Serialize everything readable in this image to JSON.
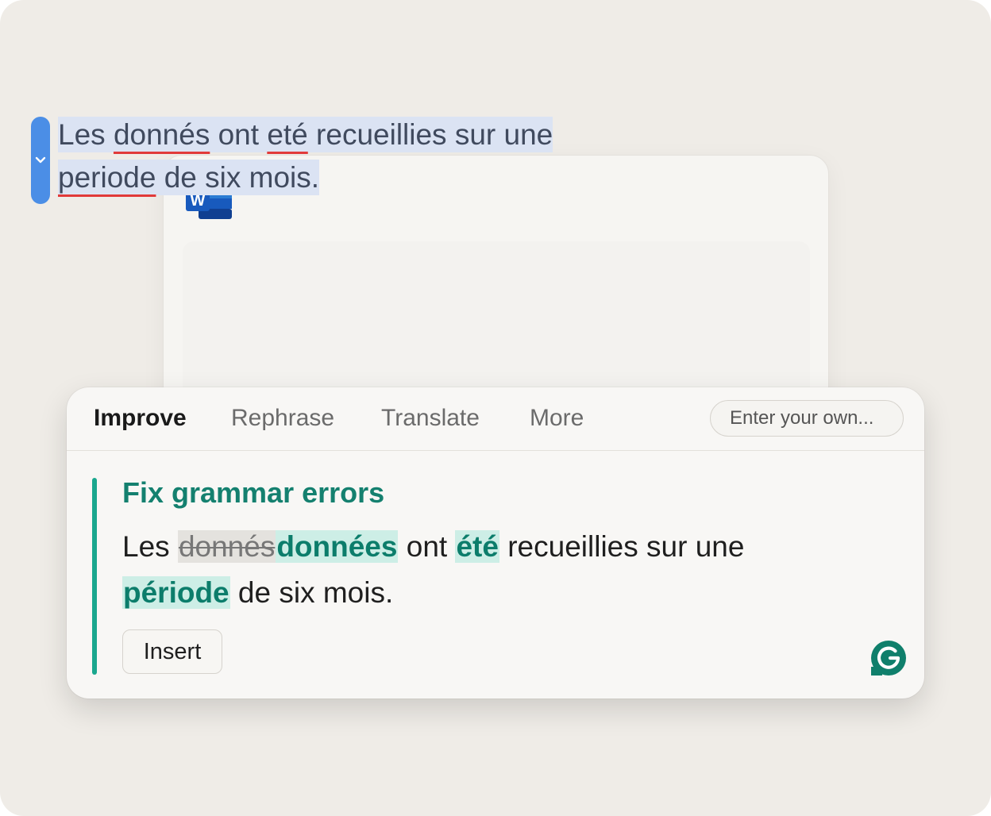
{
  "document": {
    "app_logo": "word-icon",
    "app_letter": "W",
    "text": {
      "w1": "Les ",
      "w2": "donnés",
      "w3": " ont ",
      "w4": "eté",
      "w5": " recueillies sur une ",
      "w6": "periode",
      "w7": " de six mois."
    }
  },
  "panel": {
    "tabs": [
      {
        "label": "Improve",
        "active": true
      },
      {
        "label": "Rephrase",
        "active": false
      },
      {
        "label": "Translate",
        "active": false
      },
      {
        "label": "More",
        "active": false
      }
    ],
    "custom_prompt": {
      "placeholder": "Enter your own..."
    },
    "suggestion": {
      "title": "Fix grammar errors",
      "parts": {
        "p1": "Les ",
        "removed": "donnés",
        "added1": "données",
        "p2": " ont ",
        "added2": "été",
        "p3": " recueillies sur une ",
        "added3": "période",
        "p4": " de six mois."
      },
      "insert_label": "Insert"
    },
    "brand_icon": "grammarly-icon"
  },
  "colors": {
    "accent": "#1aa78e",
    "error_underline": "#e13a3a",
    "selection": "#dbe3f3",
    "handle": "#4b8ee6"
  }
}
